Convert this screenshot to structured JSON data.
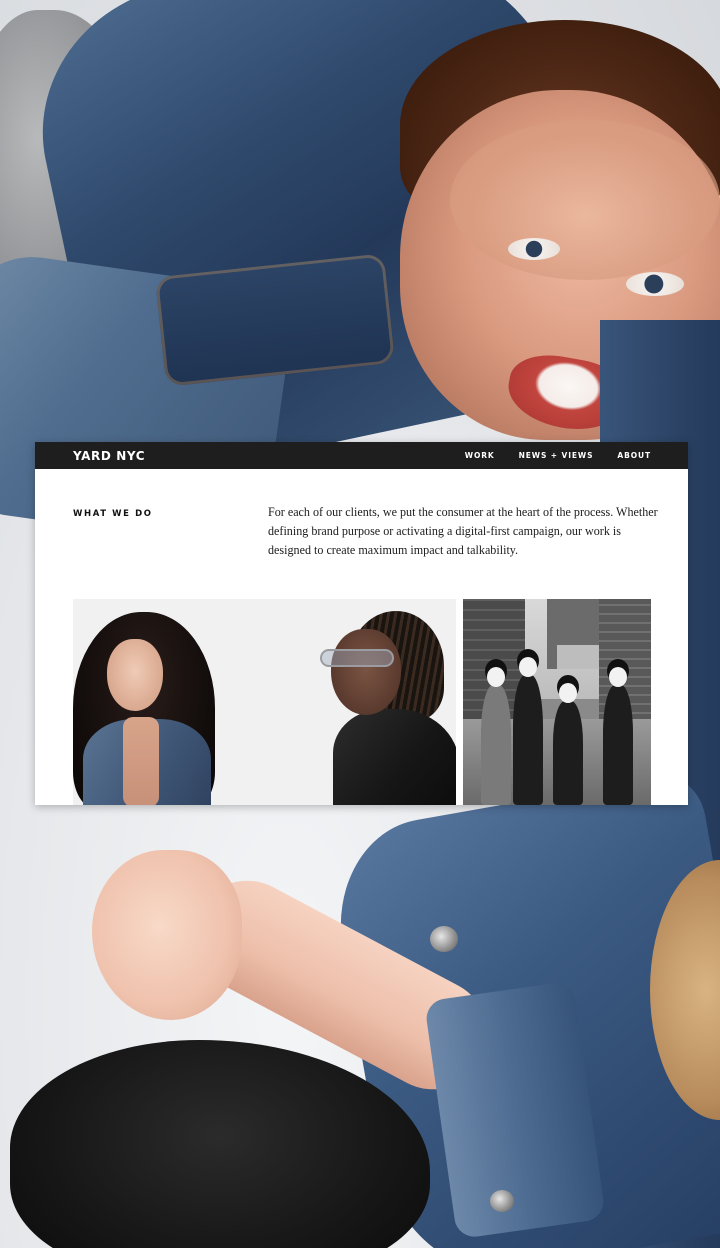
{
  "site": {
    "logo": "YARD NYC",
    "nav": [
      {
        "label": "WORK"
      },
      {
        "label": "NEWS + VIEWS"
      },
      {
        "label": "ABOUT"
      }
    ]
  },
  "section": {
    "label": "WHAT WE DO",
    "body": "For each of our clients, we put the consumer at the heart of the process. Whether defining brand purpose or activating a digital-first campaign, our work is designed to create maximum impact and talkability."
  },
  "colors": {
    "topbar": "#1e1e1e",
    "card": "#ffffff",
    "text": "#1c1c1c"
  }
}
